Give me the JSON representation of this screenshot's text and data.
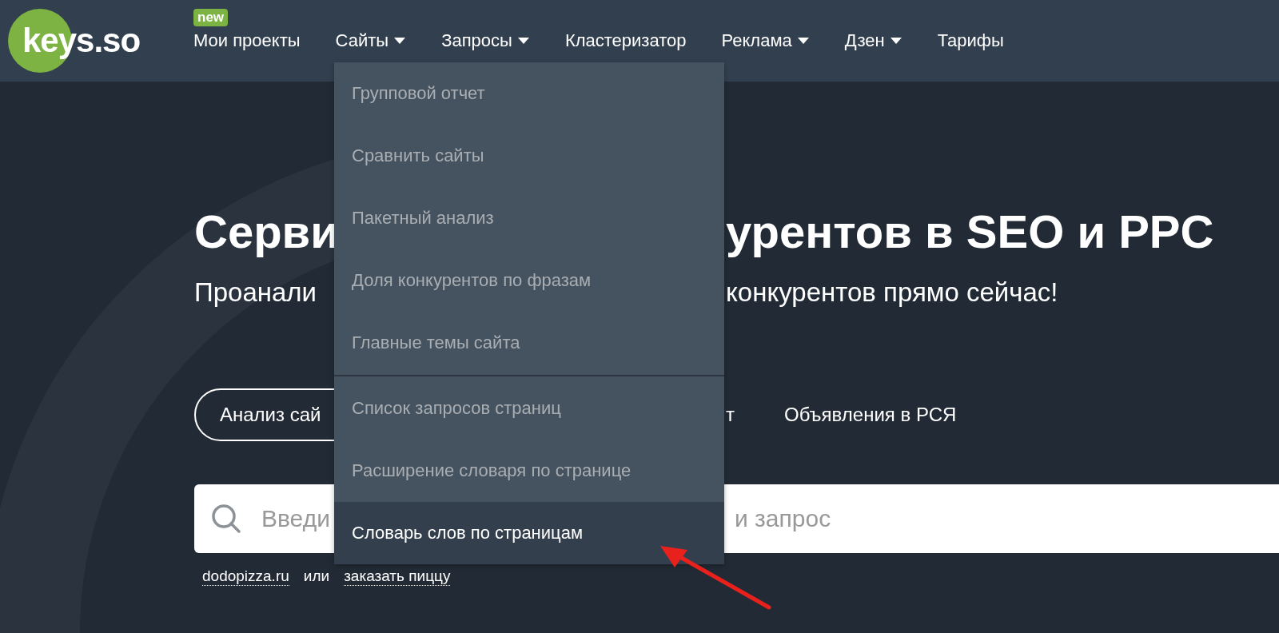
{
  "logo": {
    "text": "keys.so"
  },
  "nav": [
    {
      "label": "Мои проекты",
      "kind": "link",
      "badge": "new"
    },
    {
      "label": "Сайты",
      "kind": "dropdown"
    },
    {
      "label": "Запросы",
      "kind": "dropdown"
    },
    {
      "label": "Кластеризатор",
      "kind": "link"
    },
    {
      "label": "Реклама",
      "kind": "dropdown"
    },
    {
      "label": "Дзен",
      "kind": "dropdown"
    },
    {
      "label": "Тарифы",
      "kind": "link"
    }
  ],
  "dropdown_menu": {
    "groups": [
      [
        {
          "label": "Групповой отчет",
          "selected": false
        },
        {
          "label": "Сравнить сайты",
          "selected": false
        },
        {
          "label": "Пакетный анализ",
          "selected": false
        },
        {
          "label": "Доля конкурентов по фразам",
          "selected": false
        },
        {
          "label": "Главные темы сайта",
          "selected": false
        }
      ],
      [
        {
          "label": "Список запросов страниц",
          "selected": false
        },
        {
          "label": "Расширение словаря по странице",
          "selected": false
        },
        {
          "label": "Словарь слов по страницам",
          "selected": true
        }
      ]
    ]
  },
  "hero": {
    "title_start": "Серви",
    "title_end": "урентов в SEO и PPC",
    "subtitle_start": "Проанали",
    "subtitle_end": "конкурентов прямо сейчас!"
  },
  "tabs": [
    {
      "label": "Анализ сай",
      "selected": true
    },
    {
      "label": "т",
      "selected": false
    },
    {
      "label": "Объявления в РСЯ",
      "selected": false
    }
  ],
  "search": {
    "placeholder": "Введи",
    "placeholder_end": "и запрос"
  },
  "examples": [
    {
      "kind": "link",
      "text": "dodopizza.ru"
    },
    {
      "kind": "text",
      "text": "или"
    },
    {
      "kind": "link",
      "text": "заказать пиццу"
    }
  ]
}
